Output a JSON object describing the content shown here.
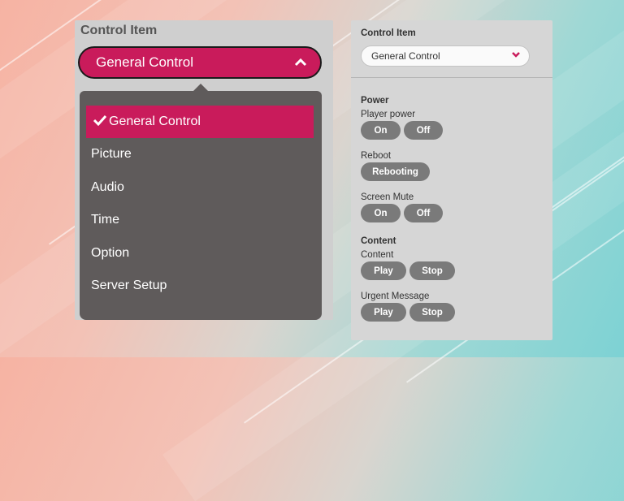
{
  "zoom": {
    "title": "Control Item",
    "selected_value": "General Control",
    "options": [
      "General Control",
      "Picture",
      "Audio",
      "Time",
      "Option",
      "Server Setup"
    ]
  },
  "panel": {
    "title": "Control Item",
    "select_value": "General Control",
    "power": {
      "heading": "Power",
      "player_power": {
        "label": "Player power",
        "on": "On",
        "off": "Off"
      },
      "reboot": {
        "label": "Reboot",
        "button": "Rebooting"
      },
      "screen_mute": {
        "label": "Screen Mute",
        "on": "On",
        "off": "Off"
      }
    },
    "content": {
      "heading": "Content",
      "content_row": {
        "label": "Content",
        "play": "Play",
        "stop": "Stop"
      },
      "urgent": {
        "label": "Urgent Message",
        "play": "Play",
        "stop": "Stop"
      }
    }
  },
  "colors": {
    "accent": "#c91b5b",
    "dropdown_bg": "#5f5b5b",
    "pill": "#7a7a7a"
  },
  "icons": {
    "chevron": "chevron-icon",
    "check": "check-icon"
  }
}
